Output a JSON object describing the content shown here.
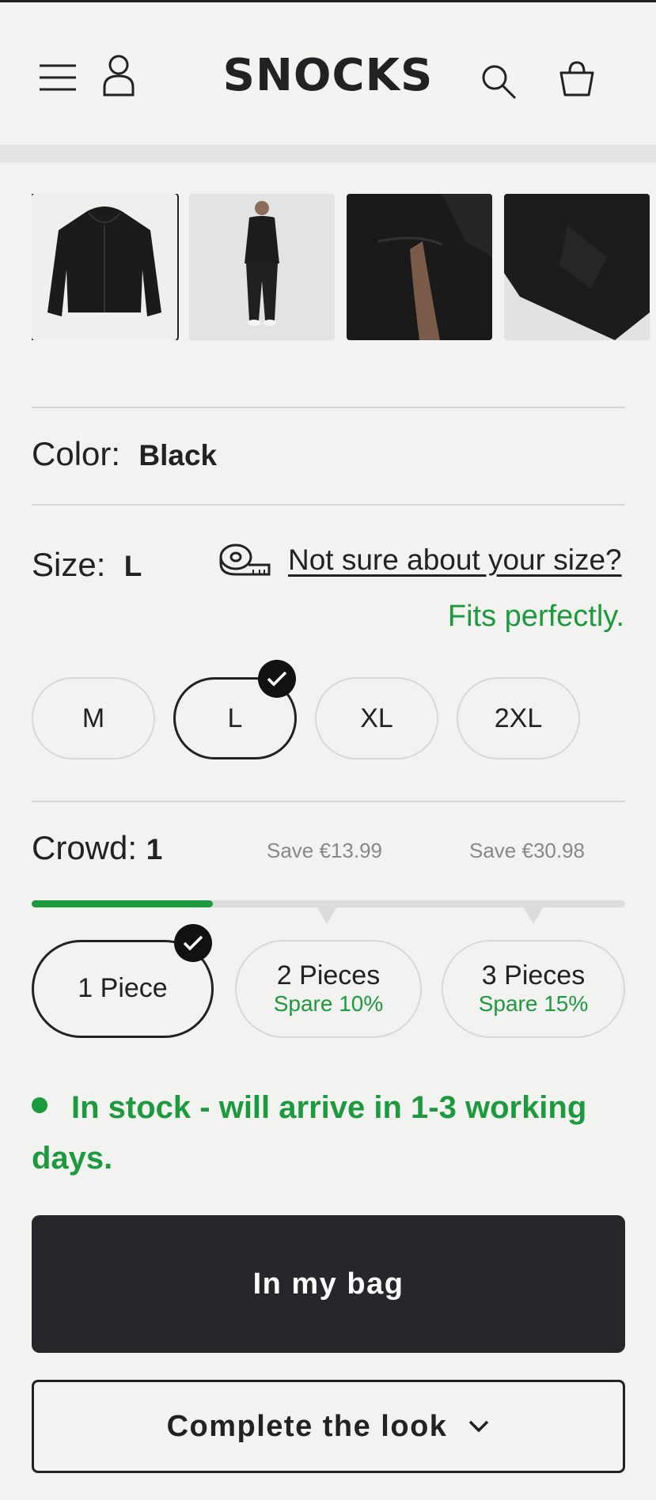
{
  "header": {
    "brand": "SNOCKS",
    "icons": [
      "menu-icon",
      "account-icon",
      "search-icon",
      "bag-icon"
    ]
  },
  "gallery": {
    "thumbnails": [
      {
        "name": "hoodie-front",
        "selected": true
      },
      {
        "name": "model-full-body",
        "selected": false
      },
      {
        "name": "pocket-detail",
        "selected": false
      },
      {
        "name": "cuff-detail",
        "selected": false
      }
    ]
  },
  "color": {
    "label": "Color:",
    "value": "Black"
  },
  "size": {
    "label": "Size:",
    "value": "L",
    "help_link": "Not sure about your size?",
    "fit_note": "Fits perfectly.",
    "options": [
      "M",
      "L",
      "XL",
      "2XL"
    ],
    "selected": "L"
  },
  "crowd": {
    "label": "Crowd:",
    "value": "1",
    "save_2": "Save €13.99",
    "save_3": "Save €30.98",
    "progress": 0.305,
    "options": [
      {
        "label": "1 Piece",
        "sub": "",
        "selected": true
      },
      {
        "label": "2 Pieces",
        "sub": "Spare  10%",
        "selected": false
      },
      {
        "label": "3 Pieces",
        "sub": "Spare  15%",
        "selected": false
      }
    ]
  },
  "stock": {
    "text": "In stock - will arrive in 1-3 working days."
  },
  "buttons": {
    "add_to_bag": "In my bag",
    "complete_look": "Complete the look"
  },
  "colors": {
    "accent_green": "#1e9a3e",
    "primary_dark": "#25272a",
    "background": "#f2f2f0"
  }
}
